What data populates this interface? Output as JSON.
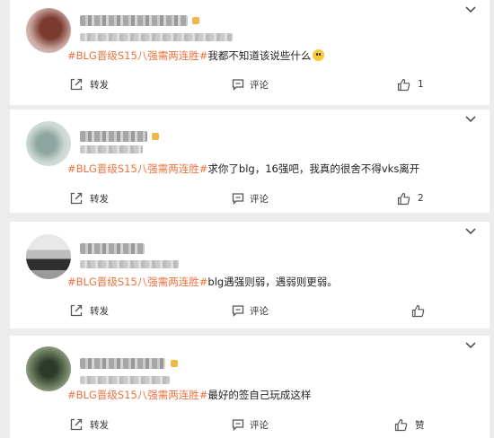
{
  "actions": {
    "repost_label": "转发",
    "comment_label": "评论"
  },
  "posts": [
    {
      "hashtag": "#BLG晋级S15八强需两连胜#",
      "text": "我都不知道该说些什么",
      "like_count": "1",
      "avatar_colors": [
        "#c9a7a0",
        "#7a3a30"
      ]
    },
    {
      "hashtag": "#BLG晋级S15八强需两连胜#",
      "text": "求你了blg，16强吧，我真的很舍不得vks离开",
      "like_count": "2",
      "avatar_colors": [
        "#8fa6a0",
        "#dfe6e2"
      ]
    },
    {
      "hashtag": "#BLG晋级S15八强需两连胜#",
      "text": "blg遇强则弱，遇弱则更弱。",
      "like_count": "",
      "avatar_colors": [
        "#bdbdbd",
        "#2f2f2f"
      ]
    },
    {
      "hashtag": "#BLG晋级S15八强需两连胜#",
      "text": "最好的签自己玩成这样",
      "like_count": "赞",
      "avatar_colors": [
        "#5d6f52",
        "#2e3a2a"
      ]
    }
  ]
}
